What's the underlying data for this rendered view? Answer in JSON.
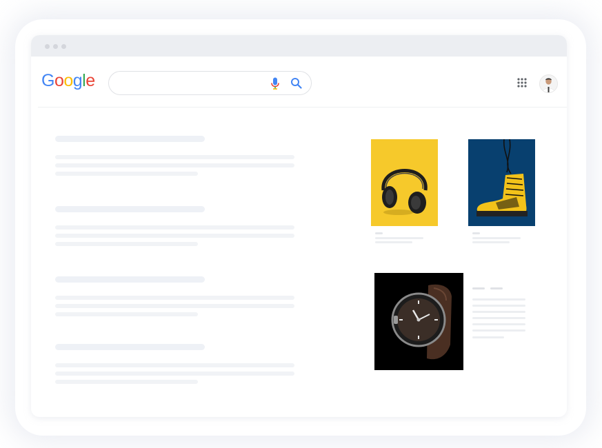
{
  "browser": {
    "window_controls": [
      "close",
      "minimize",
      "maximize"
    ]
  },
  "header": {
    "logo_letters": [
      {
        "ch": "G",
        "color": "#4285F4"
      },
      {
        "ch": "o",
        "color": "#EA4335"
      },
      {
        "ch": "o",
        "color": "#FBBC05"
      },
      {
        "ch": "g",
        "color": "#4285F4"
      },
      {
        "ch": "l",
        "color": "#34A853"
      },
      {
        "ch": "e",
        "color": "#EA4335"
      }
    ],
    "search": {
      "value": "",
      "placeholder": ""
    },
    "icons": [
      "mic-icon",
      "search-icon",
      "apps-grid-icon",
      "avatar"
    ]
  },
  "results": {
    "count": 4,
    "placeholder_lines_per_result": 3
  },
  "products": [
    {
      "name": "headphones",
      "image_bg": "#f6c92b",
      "icon": "headphones-icon"
    },
    {
      "name": "yellow-boot",
      "image_bg": "#08406f",
      "icon": "boot-icon"
    },
    {
      "name": "wristwatch",
      "image_bg": "#000000",
      "icon": "watch-icon"
    }
  ]
}
